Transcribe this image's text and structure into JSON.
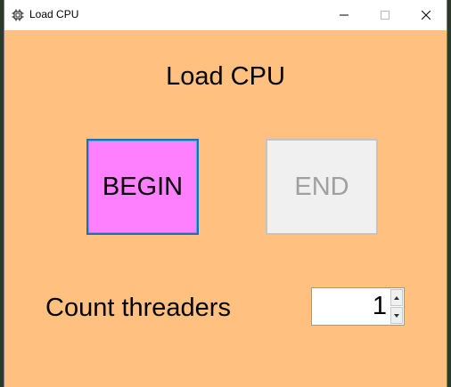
{
  "window": {
    "title": "Load CPU",
    "icon": "cpu-chip-icon",
    "controls": {
      "minimize_icon": "minimize-icon",
      "maximize_icon": "maximize-icon",
      "close_icon": "close-icon"
    }
  },
  "main": {
    "heading": "Load CPU",
    "begin_label": "BEGIN",
    "end_label": "END",
    "threads_label": "Count threaders",
    "threads_value": "1"
  },
  "colors": {
    "background": "#ffc080",
    "begin_button": "#ff80ff",
    "begin_border": "#1c6fb8",
    "end_button": "#f0f0f0",
    "end_text": "#a0a0a0"
  }
}
